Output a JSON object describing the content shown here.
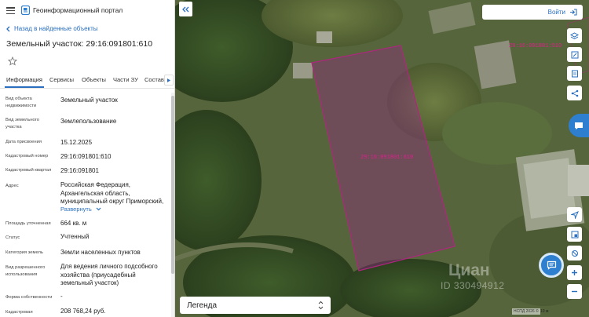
{
  "header": {
    "app_title": "Геоинформационный портал"
  },
  "nav": {
    "back_label": "Назад в найденные объекты"
  },
  "object": {
    "title": "Земельный участок: 29:16:091801:610"
  },
  "tabs": [
    {
      "label": "Информация",
      "active": true
    },
    {
      "label": "Сервисы",
      "active": false
    },
    {
      "label": "Объекты",
      "active": false
    },
    {
      "label": "Части ЗУ",
      "active": false
    },
    {
      "label": "Состав",
      "active": false
    }
  ],
  "fields": [
    {
      "label": "Вид объекта недвижимости",
      "value": "Земельный участок"
    },
    {
      "label": "Вид земельного участка",
      "value": "Землепользование"
    },
    {
      "label": "Дата присвоения",
      "value": "15.12.2025"
    },
    {
      "label": "Кадастровый номер",
      "value": "29:16:091801:610"
    },
    {
      "label": "Кадастровый квартал",
      "value": "29:16:091801"
    },
    {
      "label": "Адрес",
      "value": "Российская Федерация, Архангельская область, муниципальный округ Приморский,",
      "expand": "Развернуть"
    },
    {
      "label": "Площадь уточненная",
      "value": "664 кв. м"
    },
    {
      "label": "Статус",
      "value": "Учтенный"
    },
    {
      "label": "Категория земель",
      "value": "Земли населенных пунктов"
    },
    {
      "label": "Вид разрешенного использования",
      "value": "Для ведения личного подсобного хозяйства (приусадебный земельный участок)"
    },
    {
      "label": "Форма собственности",
      "value": "-"
    },
    {
      "label": "Кадастровая",
      "value": "208 768,24 руб."
    }
  ],
  "map": {
    "login_label": "Войти",
    "legend_label": "Легенда",
    "parcel_label": "29:16:091801:610",
    "neighbor_label": "29:16:091801:510",
    "watermark": "Циан",
    "watermark_id": "ID 330494912",
    "attribution": "НСПД 2026 ©",
    "scale": "10 м",
    "colors": {
      "parcel_stroke": "#b0257f",
      "parcel_fill": "rgba(150,40,140,0.38)",
      "accent": "#2e7fd0",
      "link": "#2a6fbf"
    }
  },
  "icons": {
    "tools": [
      "layers-icon",
      "edit-icon",
      "print-icon",
      "share-icon",
      "location-icon",
      "minimap-icon",
      "satellite-icon",
      "zoom-in-icon",
      "zoom-out-icon"
    ]
  }
}
